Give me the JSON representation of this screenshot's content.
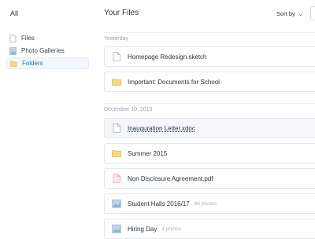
{
  "sidebar": {
    "all_label": "All",
    "items": [
      {
        "label": "Files",
        "icon": "file-icon"
      },
      {
        "label": "Photo Galleries",
        "icon": "image-icon"
      },
      {
        "label": "Folders",
        "icon": "folder-icon",
        "active": true
      }
    ]
  },
  "header": {
    "title": "Your Files",
    "sort_label": "Sort by"
  },
  "groups": [
    {
      "label": "Yesterday",
      "rows": [
        {
          "name": "Homepage Redesign.sketch",
          "icon": "file-icon",
          "meta": ""
        },
        {
          "name": "Important: Documents for School",
          "icon": "folder-icon",
          "meta": ""
        }
      ]
    },
    {
      "label": "December 10, 2015",
      "rows": [
        {
          "name": "Inauguration Letter.xdoc",
          "icon": "file-icon",
          "meta": "",
          "hovered": true
        },
        {
          "name": "Summer 2015",
          "icon": "folder-icon",
          "meta": ""
        },
        {
          "name": "Non Disclosure Agreement.pdf",
          "icon": "pdf-icon",
          "meta": ""
        },
        {
          "name": "Student Halls 2016/17",
          "icon": "image-icon",
          "meta": "86 photos"
        },
        {
          "name": "Hiring Day",
          "icon": "image-icon",
          "meta": "4 photos"
        }
      ]
    }
  ],
  "colors": {
    "accent": "#2a6fb5",
    "folder": "#f3d98b",
    "pdf": "#f0b6c2",
    "image": "#bcd3ea"
  }
}
